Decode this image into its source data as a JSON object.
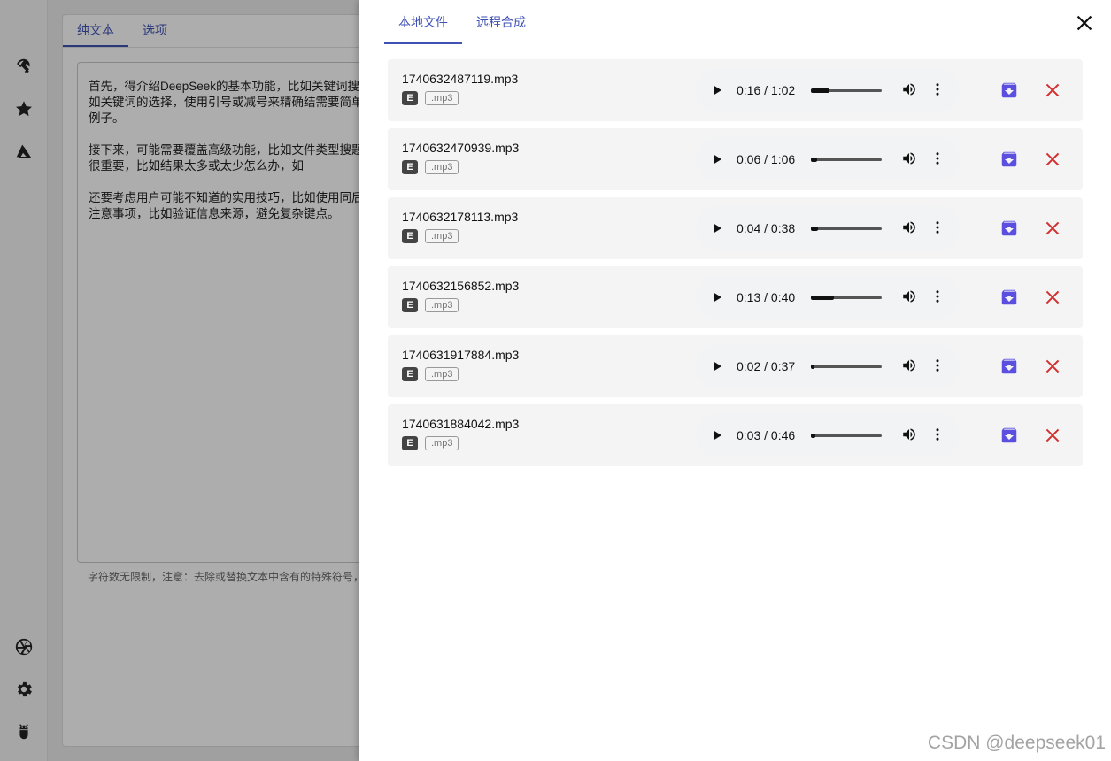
{
  "background": {
    "tabs": [
      "纯文本",
      "选项"
    ],
    "text_paragraphs": [
      "首先，得介绍DeepSeek的基本功能，比如关键词搜解，比如关键词的选择，使用引号或减号来精确结需要简单明了的例子。",
      "接下来，可能需要覆盖高级功能，比如文件类型搜题部分也很重要，比如结果太多或太少怎么办，如",
      "还要考虑用户可能不知道的实用技巧，比如使用同后，加上注意事项，比如验证信息来源，避免复杂键点。"
    ],
    "hint": "字符数无限制，注意：去除或替换文本中含有的特殊符号，"
  },
  "drawer": {
    "tabs": [
      {
        "label": "本地文件",
        "active": true
      },
      {
        "label": "远程合成",
        "active": false
      }
    ],
    "files": [
      {
        "name": "1740632487119.mp3",
        "badge": "E",
        "ext": ".mp3",
        "time": "0:16 / 1:02",
        "progress": 0.258
      },
      {
        "name": "1740632470939.mp3",
        "badge": "E",
        "ext": ".mp3",
        "time": "0:06 / 1:06",
        "progress": 0.091
      },
      {
        "name": "1740632178113.mp3",
        "badge": "E",
        "ext": ".mp3",
        "time": "0:04 / 0:38",
        "progress": 0.105
      },
      {
        "name": "1740632156852.mp3",
        "badge": "E",
        "ext": ".mp3",
        "time": "0:13 / 0:40",
        "progress": 0.325
      },
      {
        "name": "1740631917884.mp3",
        "badge": "E",
        "ext": ".mp3",
        "time": "0:02 / 0:37",
        "progress": 0.054
      },
      {
        "name": "1740631884042.mp3",
        "badge": "E",
        "ext": ".mp3",
        "time": "0:03 / 0:46",
        "progress": 0.065
      }
    ]
  },
  "watermark": "CSDN @deepseek01",
  "colors": {
    "accent": "#3f51b5",
    "download": "#5b4fe0",
    "delete": "#d32f2f"
  },
  "icons": [
    "umbrella-icon",
    "star-icon",
    "azure-icon",
    "aperture-icon",
    "gear-icon",
    "bug-icon",
    "close-icon",
    "play-icon",
    "volume-icon",
    "more-vert-icon",
    "download-icon",
    "delete-icon"
  ]
}
